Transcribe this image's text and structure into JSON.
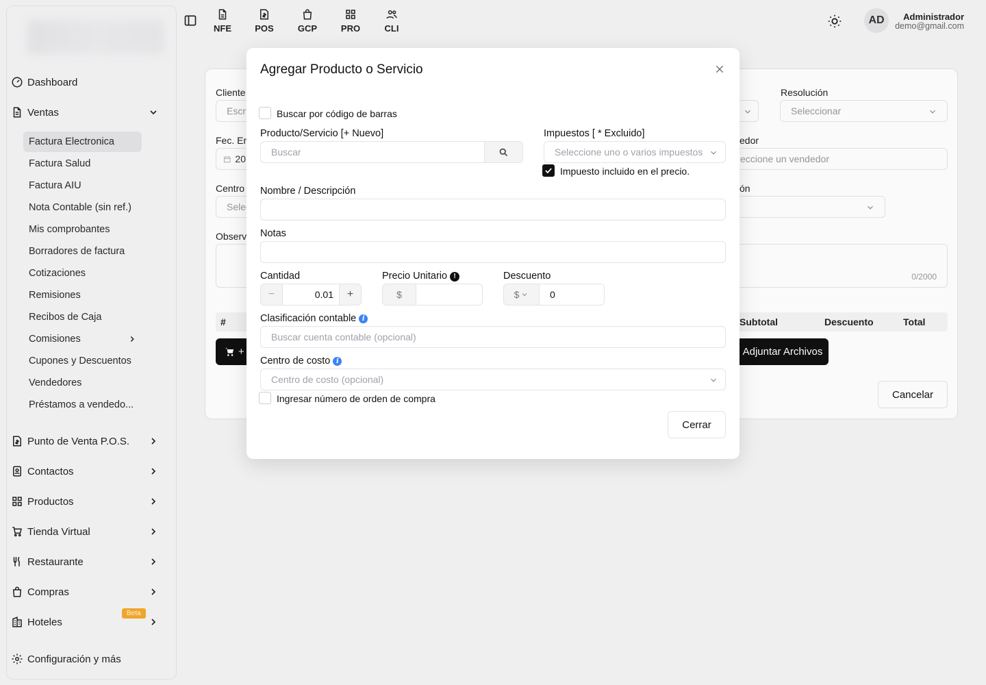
{
  "topbar": {
    "apps": [
      {
        "label": "NFE",
        "icon": "file-text-icon"
      },
      {
        "label": "POS",
        "icon": "file-dollar-icon"
      },
      {
        "label": "GCP",
        "icon": "shopping-bag-icon"
      },
      {
        "label": "PRO",
        "icon": "grid-icon"
      },
      {
        "label": "CLI",
        "icon": "users-icon"
      }
    ],
    "user": {
      "initials": "AD",
      "name": "Administrador",
      "email": "demo@gmail.com"
    }
  },
  "sidebar": {
    "items": [
      {
        "label": "Dashboard"
      },
      {
        "label": "Ventas"
      },
      {
        "label": "Punto de Venta P.O.S."
      },
      {
        "label": "Contactos"
      },
      {
        "label": "Productos"
      },
      {
        "label": "Tienda Virtual"
      },
      {
        "label": "Restaurante"
      },
      {
        "label": "Compras"
      },
      {
        "label": "Hoteles",
        "badge": "Beta"
      },
      {
        "label": "Configuración y más"
      }
    ],
    "ventas_sub": [
      "Factura Electronica",
      "Factura Salud",
      "Factura AIU",
      "Nota Contable (sin ref.)",
      "Mis comprobantes",
      "Borradores de factura",
      "Cotizaciones",
      "Remisiones",
      "Recibos de Caja",
      "Comisiones",
      "Cupones y Descuentos",
      "Vendedores",
      "Préstamos a vendedo..."
    ]
  },
  "background_form": {
    "cliente_label": "Cliente",
    "cliente_placeholder": "Escri",
    "resolucion_label": "Resolución",
    "resolucion_placeholder": "Seleccionar",
    "fecha_label": "Fec. Em",
    "fecha_value": "20",
    "vendedor_label": "edor",
    "vendedor_placeholder": "eccione un vendedor",
    "centro_label": "Centro",
    "centro_placeholder": "Selec",
    "right_label": "ón",
    "observ_label": "Observ",
    "char_count": "0/2000",
    "table_headers": {
      "num": "#",
      "subtotal": "Subtotal",
      "descuento": "Descuento",
      "total": "Total"
    },
    "add_button": "+",
    "attach_button": "Adjuntar Archivos",
    "cancel_button": "Cancelar"
  },
  "modal": {
    "title": "Agregar Producto o Servicio",
    "barcode_label": "Buscar por código de barras",
    "producto_label": "Producto/Servicio [+ Nuevo]",
    "producto_placeholder": "Buscar",
    "impuestos_label": "Impuestos [ * Excluido]",
    "impuestos_placeholder": "Seleccione uno o varios impuestos",
    "impuesto_incluido_label": "Impuesto incluido en el precio.",
    "nombre_label": "Nombre / Descripción",
    "nombre_value": "",
    "notas_label": "Notas",
    "notas_value": "",
    "cantidad_label": "Cantidad",
    "cantidad_value": "0.01",
    "precio_label": "Precio Unitario",
    "precio_currency": "$",
    "precio_value": "",
    "descuento_label": "Descuento",
    "descuento_currency": "$",
    "descuento_value": "0",
    "clasificacion_label": "Clasificación contable",
    "clasificacion_placeholder": "Buscar cuenta contable (opcional)",
    "centro_costo_label": "Centro de costo",
    "centro_costo_placeholder": "Centro de costo (opcional)",
    "orden_compra_label": "Ingresar número de orden de compra",
    "cerrar_button": "Cerrar"
  }
}
